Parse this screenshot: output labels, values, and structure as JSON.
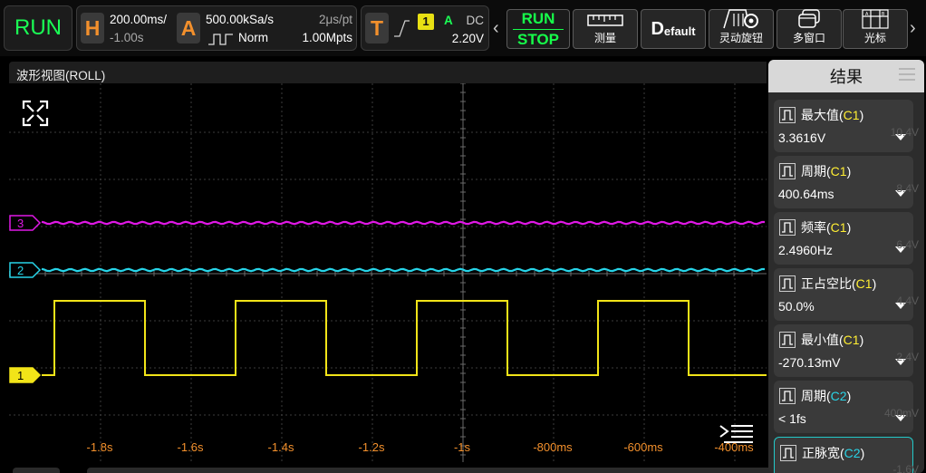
{
  "top_bar": {
    "run_state": "RUN",
    "horizontal": {
      "letter": "H",
      "timebase": "200.00ms/",
      "offset": "-1.00s"
    },
    "acquire": {
      "letter": "A",
      "sample_rate": "500.00kSa/s",
      "per_point": "2μs/pt",
      "mode": "Norm",
      "depth": "1.00Mpts"
    },
    "trigger": {
      "letter": "T",
      "channel": "1",
      "source_letter": "A",
      "coupling": "DC",
      "level": "2.20V"
    },
    "scroll_left": "‹",
    "scroll_right": "›",
    "run_stop": {
      "top": "RUN",
      "bottom": "STOP"
    },
    "buttons": [
      {
        "label": "测量",
        "icon": "ruler-icon"
      },
      {
        "label": "efault",
        "icon_text": "D"
      },
      {
        "label": "灵动旋钮",
        "icon": "knob-gear-icon"
      },
      {
        "label": "多窗口",
        "icon": "multi-window-icon"
      },
      {
        "label": "光标",
        "icon": "cursor-icon"
      }
    ]
  },
  "waveform": {
    "title": "波形视图(ROLL)",
    "time_labels": [
      "-1.8s",
      "-1.6s",
      "-1.4s",
      "-1.2s",
      "-1s",
      "-800ms",
      "-600ms",
      "-400ms"
    ],
    "channels": [
      {
        "id": "3",
        "color": "#e018e6"
      },
      {
        "id": "2",
        "color": "#27d4e8"
      },
      {
        "id": "1",
        "color": "#f2e418"
      }
    ],
    "ghost_scale": [
      "10.4V",
      "8.4V",
      "6.4V",
      "4.4V",
      "2.4V",
      "400mV",
      "-1.6V"
    ]
  },
  "results": {
    "title": "结果",
    "items": [
      {
        "name": "最大值",
        "channel": "C1",
        "value": "3.3616V"
      },
      {
        "name": "周期",
        "channel": "C1",
        "value": "400.64ms"
      },
      {
        "name": "频率",
        "channel": "C1",
        "value": "2.4960Hz"
      },
      {
        "name": "正占空比",
        "channel": "C1",
        "value": "50.0%"
      },
      {
        "name": "最小值",
        "channel": "C1",
        "value": "-270.13mV"
      },
      {
        "name": "周期",
        "channel": "C2",
        "value": "< 1fs"
      },
      {
        "name": "正脉宽",
        "channel": "C2",
        "value": ""
      }
    ]
  },
  "colors": {
    "ch1": "#f2e418",
    "ch2": "#27d4e8",
    "ch3": "#e018e6",
    "run": "#1aff55",
    "accent_orange": "#f3902c"
  }
}
